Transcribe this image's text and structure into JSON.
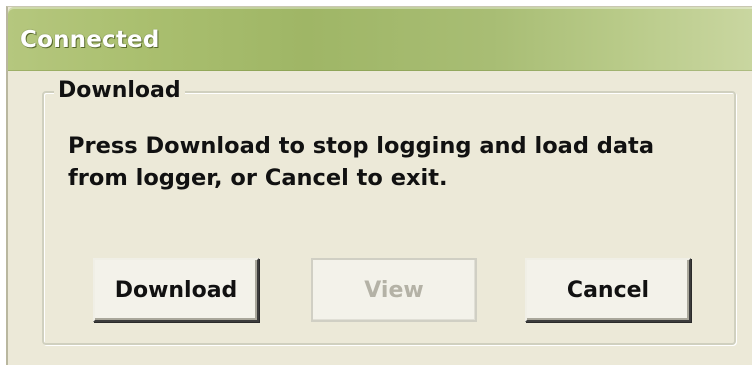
{
  "window": {
    "title": "Connected"
  },
  "group": {
    "legend": "Download",
    "message": "Press Download to stop logging and load data from logger, or Cancel to exit."
  },
  "buttons": {
    "download_label": "Download",
    "view_label": "View",
    "view_enabled": false,
    "cancel_label": "Cancel"
  },
  "colors": {
    "titlebar": "#a8bd74",
    "dialog_background": "#ece9d8",
    "disabled_text": "#b4b2a6"
  }
}
